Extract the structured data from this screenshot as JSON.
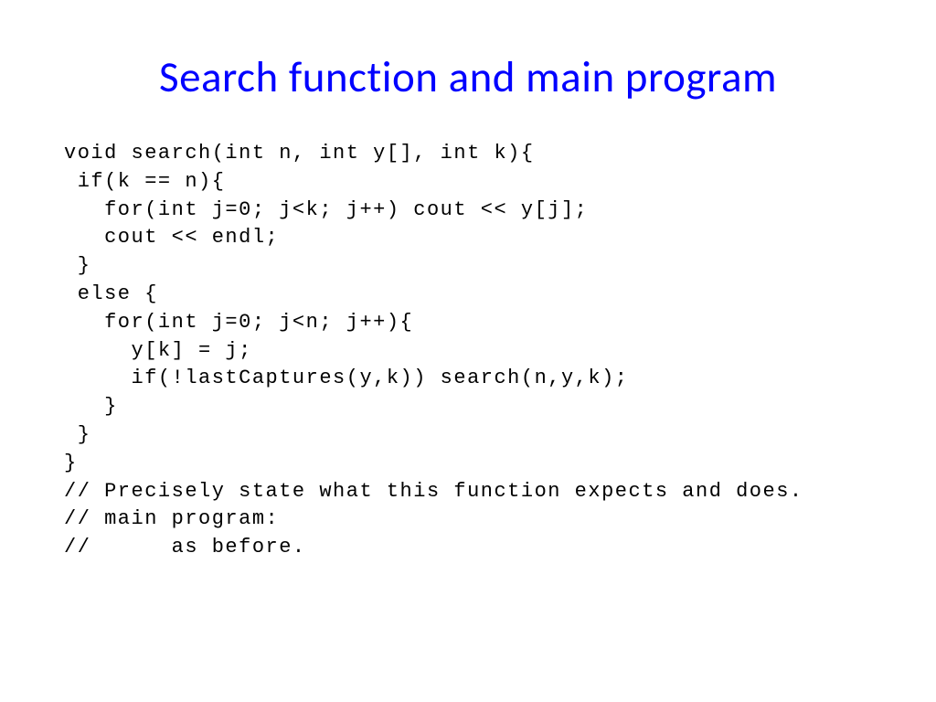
{
  "slide": {
    "title": "Search function and main program",
    "code": "void search(int n, int y[], int k){\n if(k == n){\n   for(int j=0; j<k; j++) cout << y[j];\n   cout << endl;\n }\n else {\n   for(int j=0; j<n; j++){\n     y[k] = j;\n     if(!lastCaptures(y,k)) search(n,y,k);\n   }\n }\n}\n// Precisely state what this function expects and does.\n// main program:\n//      as before."
  }
}
